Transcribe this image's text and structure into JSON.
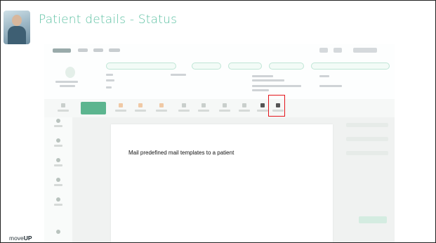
{
  "slide": {
    "title": "Patient details - Status",
    "caption": "Mail predefined mail templates to a patient",
    "brand_prefix": "move",
    "brand_suffix": "UP"
  },
  "colors": {
    "title": "#5fc2a4",
    "highlight": "#e3141b",
    "active_tool": "#5cb58f"
  },
  "icons": {
    "presenter": "person-avatar-icon",
    "mail_tool": "mail-icon"
  }
}
